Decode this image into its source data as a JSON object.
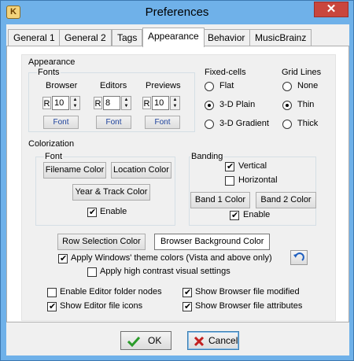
{
  "window": {
    "title": "Preferences",
    "close_glyph": "✕"
  },
  "tabs": [
    "General 1",
    "General 2",
    "Tags",
    "Appearance",
    "Behavior",
    "MusicBrainz"
  ],
  "appearance": {
    "section_title": "Appearance",
    "fonts": {
      "title": "Fonts",
      "columns": [
        {
          "label": "Browser",
          "value": "10",
          "font_button": "Font"
        },
        {
          "label": "Editors",
          "value": "8",
          "font_button": "Font"
        },
        {
          "label": "Previews",
          "value": "10",
          "font_button": "Font"
        }
      ],
      "r_label": "R"
    },
    "fixed_cells": {
      "title": "Fixed-cells",
      "options": [
        "Flat",
        "3-D Plain",
        "3-D Gradient"
      ],
      "selected": "3-D Plain"
    },
    "grid_lines": {
      "title": "Grid Lines",
      "options": [
        "None",
        "Thin",
        "Thick"
      ],
      "selected": "Thin"
    }
  },
  "colorization": {
    "title": "Colorization",
    "font": {
      "title": "Font",
      "filename_color": "Filename Color",
      "location_color": "Location Color",
      "year_track_color": "Year & Track Color",
      "enable": "Enable",
      "enable_checked": true
    },
    "banding": {
      "title": "Banding",
      "vertical": "Vertical",
      "vertical_checked": true,
      "horizontal": "Horizontal",
      "horizontal_checked": false,
      "band1": "Band 1 Color",
      "band2": "Band 2 Color",
      "enable": "Enable",
      "enable_checked": true
    },
    "row_selection_color": "Row Selection Color",
    "browser_background_color": "Browser Background Color",
    "apply_windows_theme": "Apply Windows' theme colors (Vista and above only)",
    "apply_windows_theme_checked": true,
    "apply_high_contrast": "Apply high contrast visual settings",
    "apply_high_contrast_checked": false
  },
  "options": {
    "enable_editor_folder_nodes": "Enable Editor folder nodes",
    "enable_editor_folder_nodes_checked": false,
    "show_editor_file_icons": "Show Editor file icons",
    "show_editor_file_icons_checked": true,
    "show_browser_file_modified": "Show Browser file modified",
    "show_browser_file_modified_checked": true,
    "show_browser_file_attributes": "Show Browser file attributes",
    "show_browser_file_attributes_checked": true
  },
  "buttons": {
    "ok": "OK",
    "cancel": "Cancel"
  },
  "colors": {
    "title_bar": "#6fb1e9",
    "close_button": "#c9463d",
    "ok_check": "#2a9b2a",
    "cancel_x": "#c22020"
  }
}
